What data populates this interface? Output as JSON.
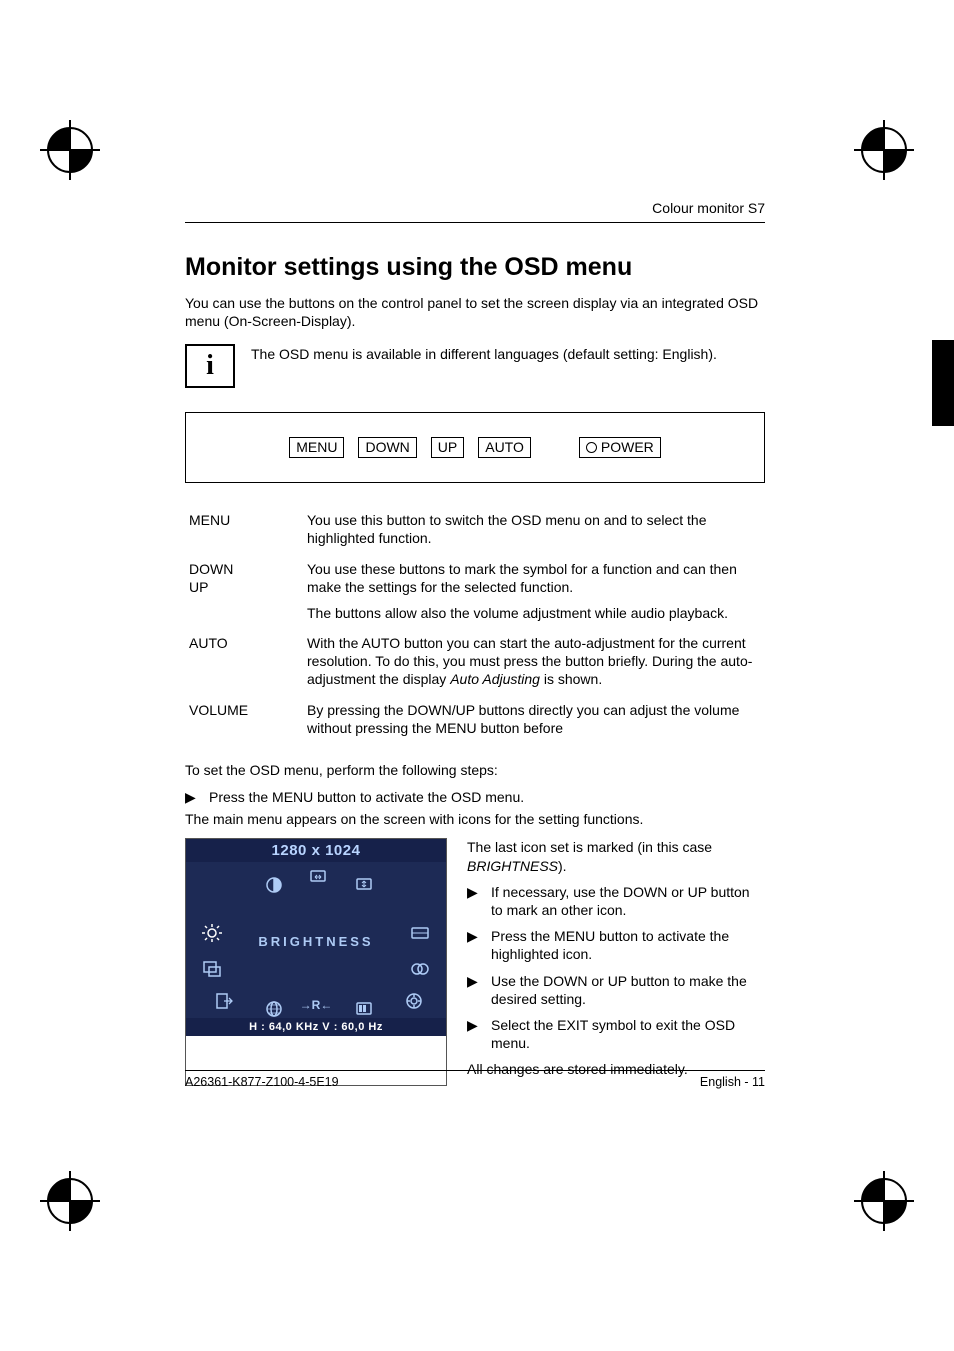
{
  "header": {
    "running": "Colour monitor S7"
  },
  "title": "Monitor settings using the OSD menu",
  "intro": "You can use the buttons on the control panel to set the screen display via an integrated OSD menu (On-Screen-Display).",
  "info": {
    "symbol": "i",
    "text": "The OSD menu is available in different languages (default setting: English)."
  },
  "panel": {
    "buttons": [
      "MENU",
      "DOWN",
      "UP",
      "AUTO",
      "POWER"
    ]
  },
  "definitions": [
    {
      "term": "MENU",
      "desc": "You use this button to switch the OSD menu on and to select the highlighted function."
    },
    {
      "term": "DOWN\nUP",
      "desc": "You use these buttons to mark the symbol for a function and can then make the settings for the selected function.",
      "desc2": "The buttons allow also the volume adjustment while audio playback."
    },
    {
      "term": "AUTO",
      "desc_pre": "With the AUTO button you can start the auto-adjustment for the current resolution. To do this, you must press the button briefly. During the auto-adjustment the display ",
      "desc_em": "Auto Adjusting",
      "desc_post": " is shown."
    },
    {
      "term": "VOLUME",
      "desc": "By pressing the DOWN/UP buttons directly you can adjust the volume without pressing the MENU button before"
    }
  ],
  "steps_intro": "To set the OSD menu, perform the following steps:",
  "step1": "Press the MENU button to activate the OSD menu.",
  "after_step1": "The main menu appears on the screen with icons for the setting functions.",
  "osd": {
    "title": "1280 x 1024",
    "label": "BRIGHTNESS",
    "reset": "→R←",
    "footer": "H : 64,0 KHz   V : 60,0 Hz"
  },
  "right": {
    "p1_pre": "The last icon set is marked (in this case ",
    "p1_em": "BRIGHTNESS",
    "p1_post": ").",
    "s1": "If necessary, use the DOWN or UP button to mark an other icon.",
    "s2": "Press the MENU button to activate the highlighted icon.",
    "s3": "Use the DOWN or UP button to make the desired setting.",
    "s4": "Select the EXIT symbol to exit the OSD menu.",
    "p2": "All changes are stored immediately."
  },
  "footer": {
    "left": "A26361-K877-Z100-4-5E19",
    "right": "English - 11"
  }
}
